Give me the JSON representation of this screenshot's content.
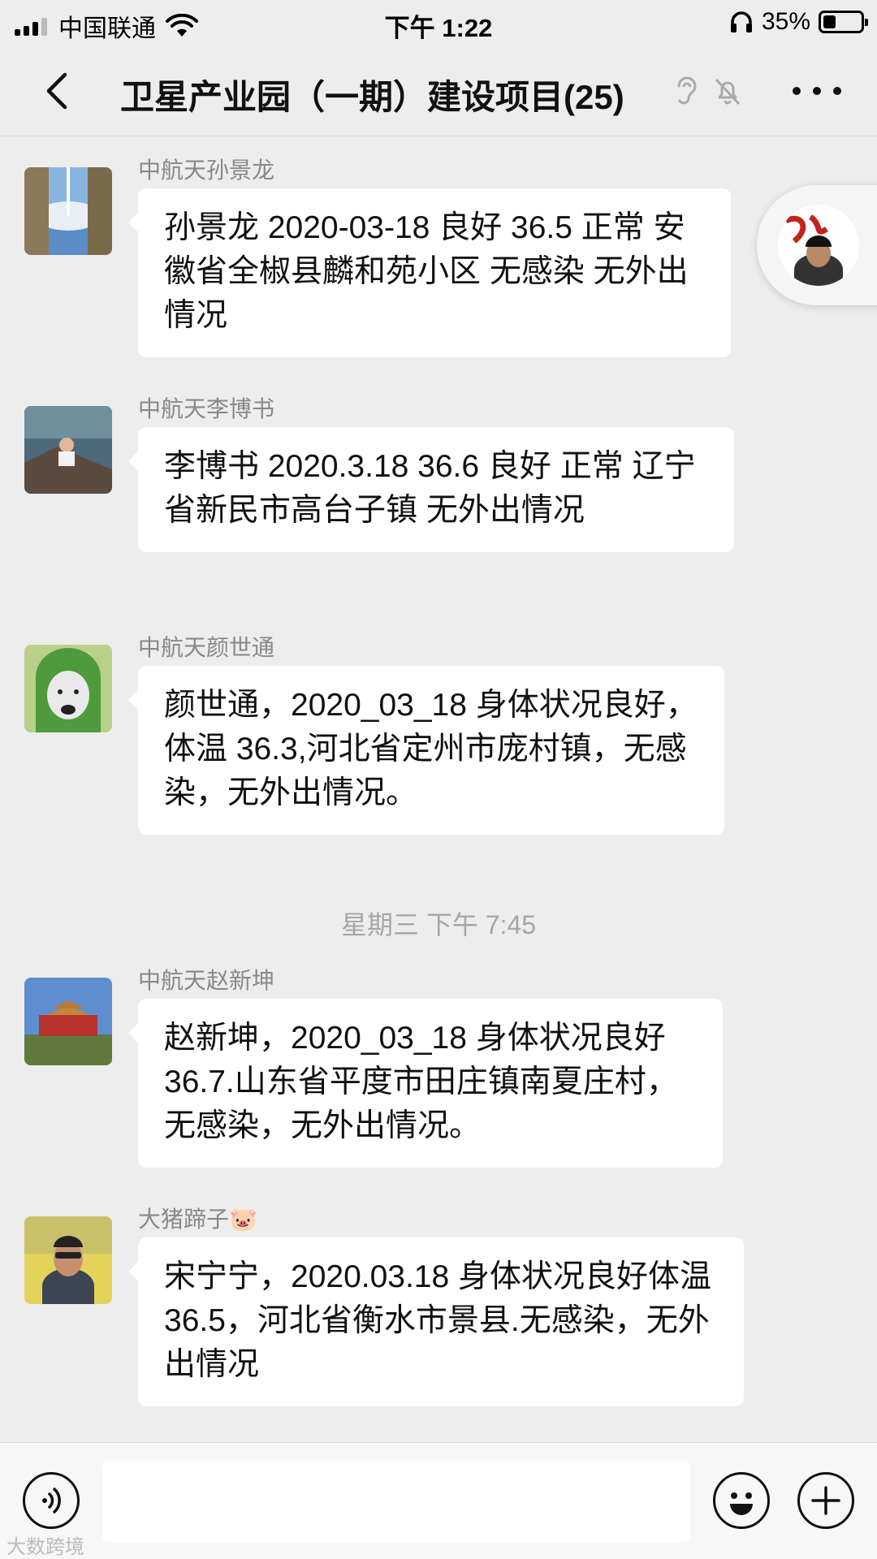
{
  "status_bar": {
    "carrier": "中国联通",
    "time": "下午 1:22",
    "battery": "35%",
    "battery_level": 0.35
  },
  "header": {
    "title": "卫星产业园（一期）建设项目(25)",
    "icons": [
      "back-icon",
      "ear-icon",
      "mute-bell-icon",
      "more-icon"
    ]
  },
  "messages": [
    {
      "sender": "中航天孙景龙",
      "text": "孙景龙 2020-03-18 良好 36.5 正常 安徽省全椒县麟和苑小区 无感染 无外出情况"
    },
    {
      "sender": "中航天李博书",
      "text": "李博书 2020.3.18 36.6 良好 正常 辽宁省新民市高台子镇 无外出情况"
    },
    {
      "sender": "中航天颜世通",
      "text": "颜世通，2020_03_18 身体状况良好，体温 36.3,河北省定州市庞村镇，无感染，无外出情况。"
    },
    {
      "sender": "中航天赵新坤",
      "text": "赵新坤，2020_03_18 身体状况良好 36.7.山东省平度市田庄镇南夏庄村，无感染，无外出情况。"
    },
    {
      "sender": "大猪蹄子🐷",
      "text": "宋宁宁，2020.03.18 身体状况良好体温 36.5，河北省衡水市景县.无感染，无外出情况"
    }
  ],
  "time_divider": "星期三 下午 7:45",
  "input_bar": {
    "text_value": "",
    "icons": [
      "voice-icon",
      "emoji-icon",
      "plus-icon"
    ]
  },
  "watermark": "大数跨境"
}
